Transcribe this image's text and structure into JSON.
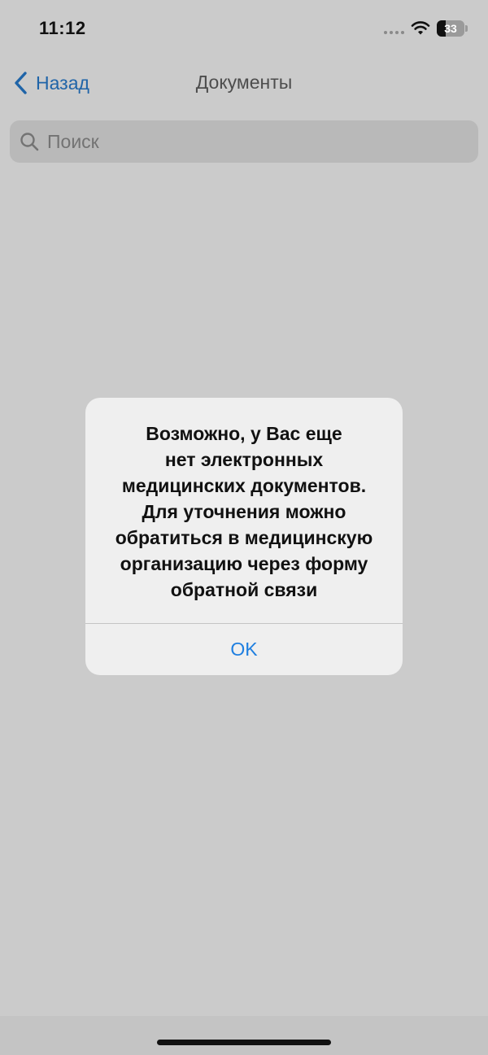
{
  "status_bar": {
    "time": "11:12",
    "battery_level": 33,
    "battery_text": "33"
  },
  "nav": {
    "back_label": "Назад",
    "title": "Документы"
  },
  "search": {
    "placeholder": "Поиск",
    "value": ""
  },
  "alert": {
    "message_lines": [
      "Возможно, у Вас еще",
      "нет электронных",
      "медицинских документов.",
      "Для уточнения можно",
      "обратиться в медицинскую",
      "организацию через форму",
      "обратной связи"
    ],
    "ok_label": "OK"
  },
  "colors": {
    "accent": "#1f64a8",
    "alert_button": "#1f7fe0",
    "dimmed_background": "#cbcbcb"
  }
}
